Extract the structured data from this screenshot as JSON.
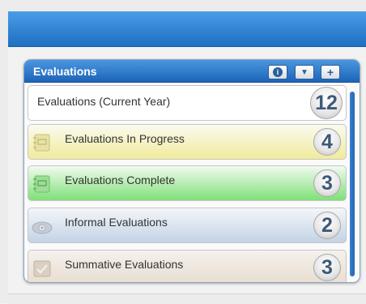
{
  "widget": {
    "title": "Evaluations",
    "buttons": {
      "info": "i",
      "filter": "▼",
      "add": "+"
    },
    "rows": [
      {
        "label": "Evaluations (Current Year)",
        "count": "12",
        "icon": null
      },
      {
        "label": "Evaluations In Progress",
        "count": "4",
        "icon": "notepad-icon"
      },
      {
        "label": "Evaluations Complete",
        "count": "3",
        "icon": "notepad-icon"
      },
      {
        "label": "Informal Evaluations",
        "count": "2",
        "icon": "eye-icon"
      },
      {
        "label": "Summative Evaluations",
        "count": "3",
        "icon": "checkbox-icon"
      }
    ]
  },
  "colors": {
    "header": "#1c64b8",
    "in_progress": "#f0eb9c",
    "complete": "#7fe078",
    "informal": "#c2d3e6",
    "summative": "#e8ddd0"
  }
}
